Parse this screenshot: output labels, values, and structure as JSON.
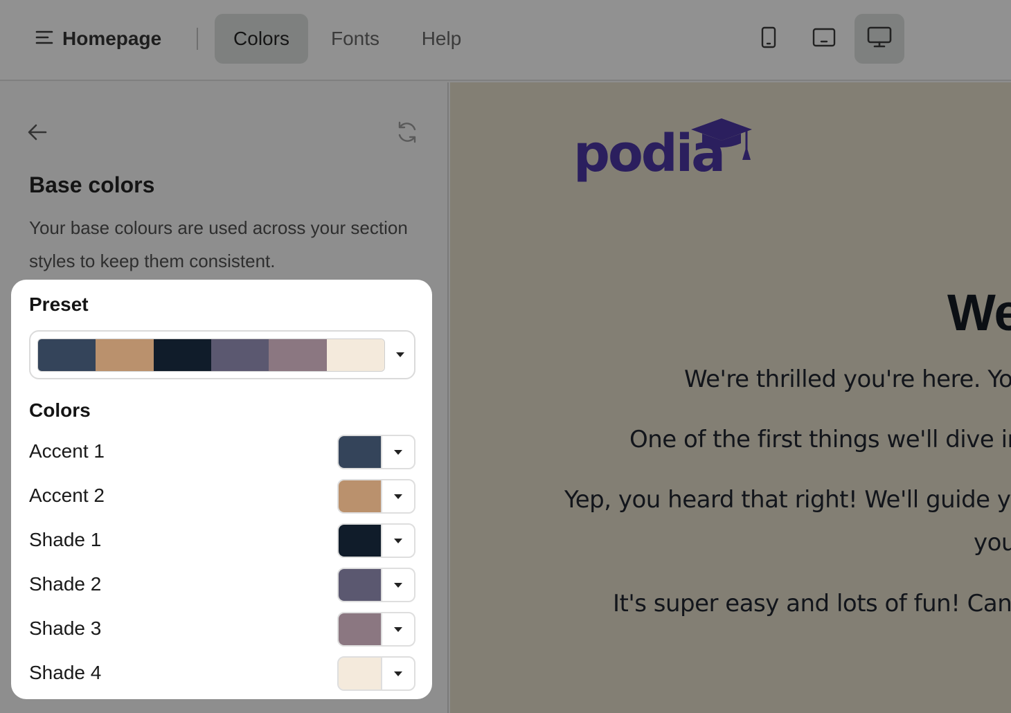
{
  "topbar": {
    "page_menu_label": "Homepage",
    "tabs": [
      {
        "label": "Colors",
        "active": true
      },
      {
        "label": "Fonts",
        "active": false
      },
      {
        "label": "Help",
        "active": false
      }
    ],
    "devices": [
      {
        "icon": "mobile-icon",
        "active": false
      },
      {
        "icon": "tablet-icon",
        "active": false
      },
      {
        "icon": "desktop-icon",
        "active": true
      }
    ]
  },
  "sidebar": {
    "title": "Base colors",
    "description": "Your base colours are used across your section styles to keep them consistent.",
    "preset": {
      "heading": "Preset",
      "swatches": [
        "#34445a",
        "#ba916d",
        "#101c2a",
        "#5b5870",
        "#8b7781",
        "#f4eadc"
      ]
    },
    "colors": {
      "heading": "Colors",
      "items": [
        {
          "label": "Accent 1",
          "color": "#34445a"
        },
        {
          "label": "Accent 2",
          "color": "#ba916d"
        },
        {
          "label": "Shade 1",
          "color": "#101c2a"
        },
        {
          "label": "Shade 2",
          "color": "#5b5870"
        },
        {
          "label": "Shade 3",
          "color": "#8b7781"
        },
        {
          "label": "Shade 4",
          "color": "#f4eadc"
        }
      ]
    }
  },
  "preview": {
    "logo_text": "podia",
    "headline": "We",
    "paragraphs": [
      "We're thrilled you're here. You",
      "One of the first things we'll dive int",
      "Yep, you heard that right! We'll guide you",
      "you",
      "It's super easy and lots of fun! Can't"
    ],
    "brand_color": "#2b1f5e",
    "background_color": "#837f74"
  }
}
